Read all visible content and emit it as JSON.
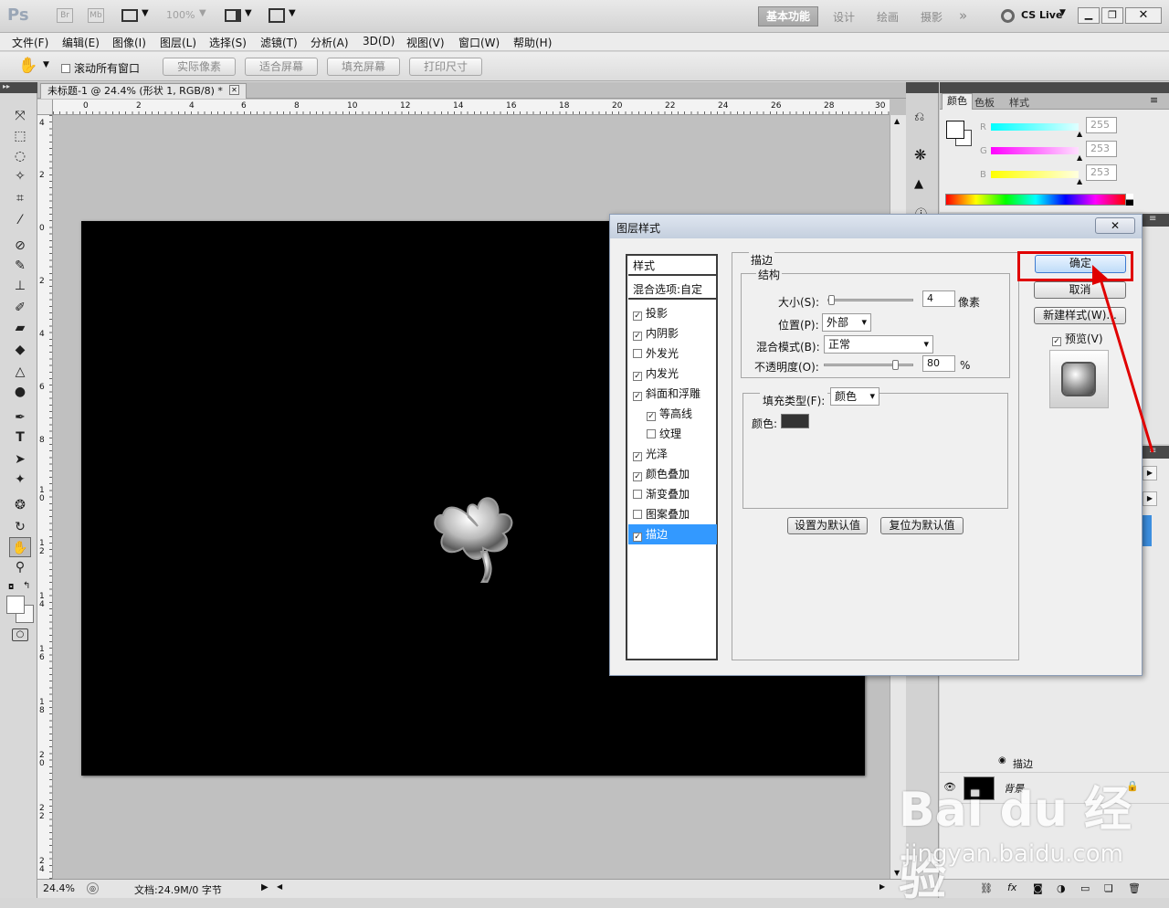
{
  "app": {
    "logo": "Ps",
    "badge_br": "Br",
    "badge_mb": "Mb",
    "zoom": "100%",
    "workspaces": [
      "基本功能",
      "设计",
      "绘画",
      "摄影"
    ],
    "more": "»",
    "cslive": "CS Live"
  },
  "menu": [
    "文件(F)",
    "编辑(E)",
    "图像(I)",
    "图层(L)",
    "选择(S)",
    "滤镜(T)",
    "分析(A)",
    "3D(D)",
    "视图(V)",
    "窗口(W)",
    "帮助(H)"
  ],
  "options": {
    "scroll_all": "滚动所有窗口",
    "buttons": [
      "实际像素",
      "适合屏幕",
      "填充屏幕",
      "打印尺寸"
    ]
  },
  "doc": {
    "tab_title": "未标题-1 @ 24.4% (形状 1, RGB/8) *",
    "ruler_h": [
      "0",
      "2",
      "4",
      "6",
      "8",
      "10",
      "12",
      "14",
      "16",
      "18",
      "20",
      "22",
      "24",
      "26",
      "28",
      "30"
    ],
    "ruler_v": [
      "4",
      "2",
      "0",
      "2",
      "4",
      "6",
      "8",
      "1 0",
      "1 2",
      "1 4",
      "1 6",
      "1 8",
      "2 0",
      "2 2",
      "2 4"
    ],
    "zoom_status": "24.4%",
    "doc_status": "文档:24.9M/0 字节"
  },
  "color_panel": {
    "tabs": [
      "颜色",
      "色板",
      "样式"
    ],
    "channels": [
      {
        "label": "R",
        "value": "255",
        "color": "#00d7d7"
      },
      {
        "label": "G",
        "value": "253",
        "color": "#e000e0"
      },
      {
        "label": "B",
        "value": "253",
        "color": "#e0e000"
      }
    ]
  },
  "layers": {
    "stroke_effect": "描边",
    "background": "背景"
  },
  "dialog": {
    "title": "图层样式",
    "styles_header": "样式",
    "blend_options": "混合选项:自定",
    "styles": [
      {
        "label": "投影",
        "checked": true,
        "indent": false
      },
      {
        "label": "内阴影",
        "checked": true,
        "indent": false
      },
      {
        "label": "外发光",
        "checked": false,
        "indent": false
      },
      {
        "label": "内发光",
        "checked": true,
        "indent": false
      },
      {
        "label": "斜面和浮雕",
        "checked": true,
        "indent": false
      },
      {
        "label": "等高线",
        "checked": true,
        "indent": true
      },
      {
        "label": "纹理",
        "checked": false,
        "indent": true
      },
      {
        "label": "光泽",
        "checked": true,
        "indent": false
      },
      {
        "label": "颜色叠加",
        "checked": true,
        "indent": false
      },
      {
        "label": "渐变叠加",
        "checked": false,
        "indent": false
      },
      {
        "label": "图案叠加",
        "checked": false,
        "indent": false
      },
      {
        "label": "描边",
        "checked": true,
        "indent": false,
        "selected": true
      }
    ],
    "section_title": "描边",
    "structure_title": "结构",
    "size_label": "大小(S):",
    "size_value": "4",
    "size_unit": "像素",
    "size_level": 0.03,
    "position_label": "位置(P):",
    "position_value": "外部",
    "blend_label": "混合模式(B):",
    "blend_value": "正常",
    "opacity_label": "不透明度(O):",
    "opacity_value": "80",
    "opacity_unit": "%",
    "opacity_level": 0.8,
    "fill_type_label": "填充类型(F):",
    "fill_type_value": "颜色",
    "color_label": "颜色:",
    "stroke_color": "#333333",
    "set_default": "设置为默认值",
    "reset_default": "复位为默认值",
    "ok": "确定",
    "cancel": "取消",
    "new_style": "新建样式(W)...",
    "preview": "预览(V)"
  },
  "watermark": {
    "brand": "Bai du 经验",
    "url": "jingyan.baidu.com"
  },
  "colors": {
    "highlight": "#e00000",
    "selected_item": "#3399ff",
    "canvas": "#000000",
    "doc_bg": "#c0c0c0"
  }
}
